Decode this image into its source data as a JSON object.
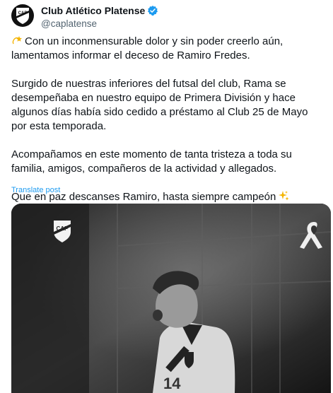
{
  "author": {
    "display_name": "Club Atlético Platense",
    "handle": "@caplatense",
    "avatar_text": "CAP"
  },
  "tweet": {
    "paragraphs": [
      "Con un inconmensurable dolor y sin poder creerlo aún, lamentamos informar el deceso de Ramiro Fredes.",
      "Surgido de nuestras inferiores del futsal del club, Rama se desempeñaba en nuestro equipo de Primera División y hace algunos días había sido cedido a préstamo al Club 25 de Mayo por esta temporada.",
      "Acompañamos en este momento de tanta tristeza a toda su familia, amigos, compañeros de la actividad y allegados.",
      "Que en paz descanses Ramiro, hasta siempre campeón"
    ],
    "emoji_start": "dizzy-star-emoji",
    "emoji_end": "sparkles-emoji"
  },
  "translate_label": "Translate post",
  "media": {
    "crest_text": "CAP",
    "icon_right": "mourning-ribbon-icon",
    "jersey_number": "14"
  },
  "colors": {
    "link": "#1d9bf0",
    "secondary_text": "#536471",
    "primary_text": "#0f1419",
    "verified": "#1d9bf0"
  }
}
